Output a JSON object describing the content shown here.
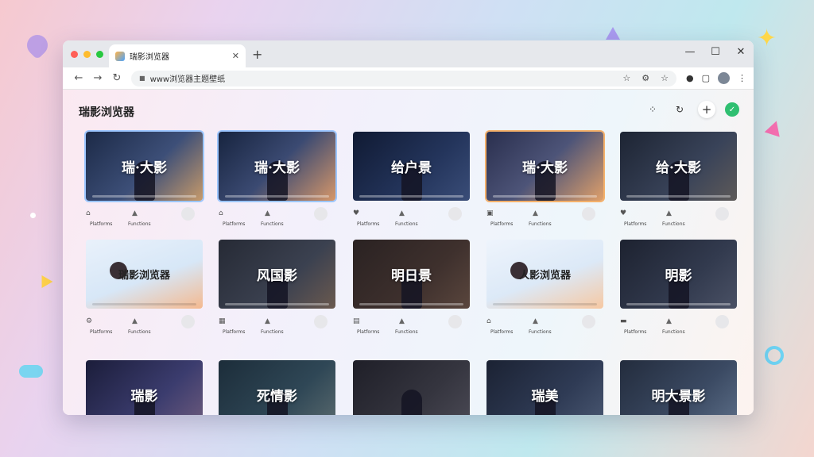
{
  "window": {
    "tab_title": "瑞影浏览器",
    "url": "www浏览器主题壁纸"
  },
  "page": {
    "title": "瑞影浏览器"
  },
  "cards": [
    {
      "title": "瑞·大影",
      "bg": "linear-gradient(135deg,#1c2a47,#3d4f78 55%,#c79a6a)",
      "light": false,
      "sel": "blue",
      "icon": "house-icon",
      "label1": "Platforms",
      "label2": "Functions"
    },
    {
      "title": "瑞·大影",
      "bg": "linear-gradient(135deg,#17243f,#3b4a72 50%,#d6976a)",
      "light": false,
      "sel": "blue",
      "icon": "house-icon",
      "label1": "Platforms",
      "label2": "Functions"
    },
    {
      "title": "给户景",
      "bg": "linear-gradient(135deg,#101a33,#24355c 60%,#3a4d78)",
      "light": false,
      "sel": "",
      "icon": "bird-icon",
      "label1": "Platforms",
      "label2": "Functions"
    },
    {
      "title": "瑞·大影",
      "bg": "linear-gradient(135deg,#2a2f4e,#4d5478 50%,#e0a06a)",
      "light": false,
      "sel": "orange",
      "icon": "image-icon",
      "label1": "Platforms",
      "label2": "Functions"
    },
    {
      "title": "给·大影",
      "bg": "linear-gradient(135deg,#1d2433,#394359 60%,#5e5a59)",
      "light": false,
      "sel": "",
      "icon": "heart-icon",
      "label1": "Platforms",
      "label2": "Functions"
    },
    {
      "title": "瑞影浏览器",
      "bg": "linear-gradient(160deg,#e9f1fb,#d7e7f7 55%,#f4b98f)",
      "light": true,
      "sel": "",
      "icon": "gear-icon",
      "label1": "Platforms",
      "label2": "Functions"
    },
    {
      "title": "风国影",
      "bg": "linear-gradient(135deg,#262a35,#3b4150 60%,#6b5a4f)",
      "light": false,
      "sel": "",
      "icon": "grid-icon",
      "label1": "Platforms",
      "label2": "Functions"
    },
    {
      "title": "明日景",
      "bg": "linear-gradient(135deg,#2a2222,#3e302d 60%,#5a463d)",
      "light": false,
      "sel": "",
      "icon": "book-icon",
      "label1": "Platforms",
      "label2": "Functions"
    },
    {
      "title": "人影浏览器",
      "bg": "linear-gradient(160deg,#eef4fc,#dce9f7 55%,#f6c8a2)",
      "light": true,
      "sel": "",
      "icon": "house-icon",
      "label1": "Platforms",
      "label2": "Functions"
    },
    {
      "title": "明影",
      "bg": "linear-gradient(135deg,#1d2230,#323a4e 60%,#4a5165)",
      "light": false,
      "sel": "",
      "icon": "folder-icon",
      "label1": "Platforms",
      "label2": "Functions"
    },
    {
      "title": "瑞影",
      "bg": "linear-gradient(135deg,#1b1d3a,#3b3c6e 60%,#6e5b7d)",
      "light": false,
      "sel": "",
      "icon": "",
      "label1": "",
      "label2": ""
    },
    {
      "title": "死情影",
      "bg": "linear-gradient(135deg,#1c2d3a,#2f4756 60%,#5a6a6e)",
      "light": false,
      "sel": "",
      "icon": "",
      "label1": "",
      "label2": ""
    },
    {
      "title": "",
      "bg": "linear-gradient(135deg,#1f1f28,#35353f 60%,#4b4a55)",
      "light": false,
      "sel": "",
      "icon": "",
      "label1": "",
      "label2": ""
    },
    {
      "title": "瑞美",
      "bg": "linear-gradient(135deg,#1b2233,#2f3b55 60%,#4a5872)",
      "light": false,
      "sel": "",
      "icon": "",
      "label1": "",
      "label2": ""
    },
    {
      "title": "明大景影",
      "bg": "linear-gradient(135deg,#232c3d,#3b4a63 60%,#5d6f88)",
      "light": false,
      "sel": "",
      "icon": "",
      "label1": "",
      "label2": ""
    }
  ]
}
